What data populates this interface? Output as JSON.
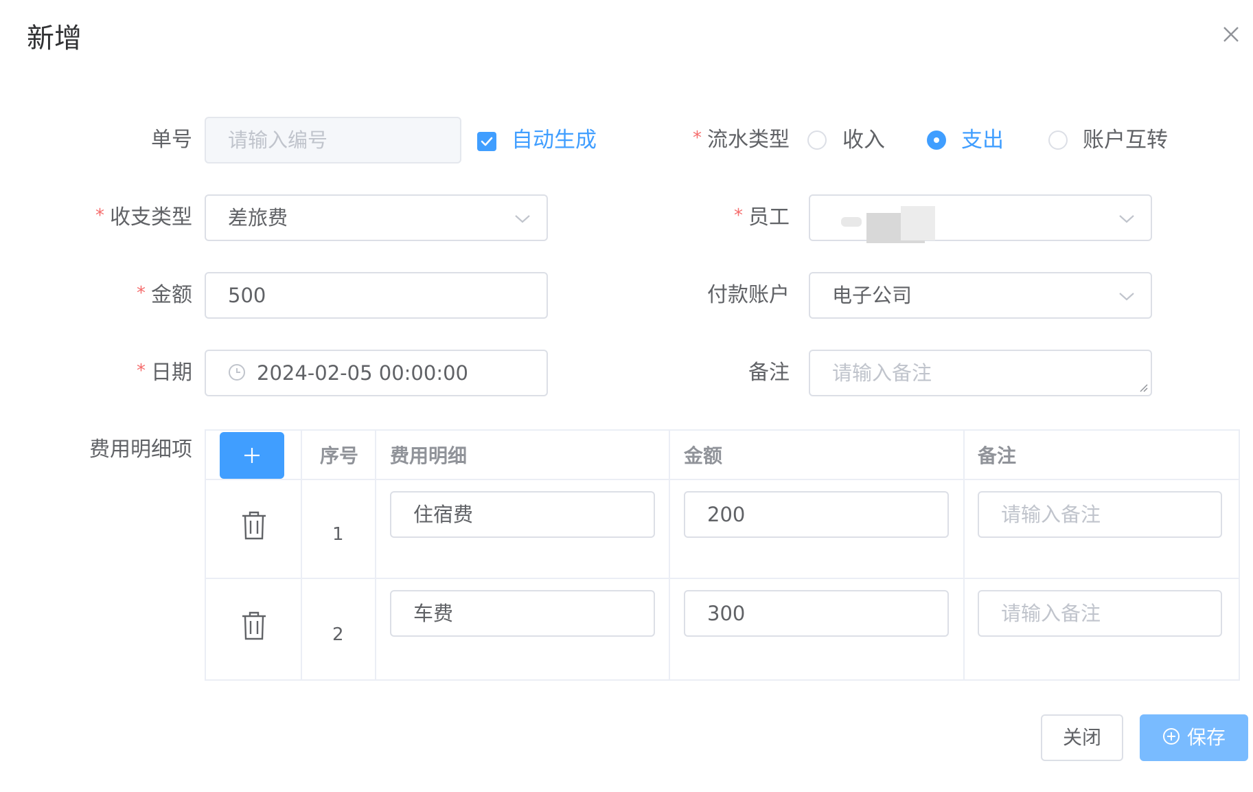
{
  "dialog": {
    "title": "新增"
  },
  "form": {
    "order_no": {
      "label": "单号",
      "placeholder": "请输入编号",
      "auto_label": "自动生成",
      "auto_checked": true
    },
    "flow_type": {
      "label": "流水类型",
      "options": [
        "收入",
        "支出",
        "账户互转"
      ],
      "selected": "支出"
    },
    "category": {
      "label": "收支类型",
      "value": "差旅费"
    },
    "employee": {
      "label": "员工",
      "value": ""
    },
    "amount": {
      "label": "金额",
      "value": "500"
    },
    "pay_account": {
      "label": "付款账户",
      "value": "电子公司"
    },
    "date": {
      "label": "日期",
      "value": "2024-02-05 00:00:00"
    },
    "remark": {
      "label": "备注",
      "placeholder": "请输入备注"
    },
    "required_mark": "*"
  },
  "details": {
    "label": "费用明细项",
    "headers": {
      "seq": "序号",
      "item": "费用明细",
      "amount": "金额",
      "remark": "备注"
    },
    "rows": [
      {
        "seq": "1",
        "item": "住宿费",
        "amount": "200",
        "remark_placeholder": "请输入备注"
      },
      {
        "seq": "2",
        "item": "车费",
        "amount": "300",
        "remark_placeholder": "请输入备注"
      }
    ]
  },
  "footer": {
    "close_label": "关闭",
    "save_label": "保存"
  },
  "colors": {
    "primary": "#409eff",
    "save_disabled": "#79bbff",
    "required": "#f56c6c",
    "border": "#dcdfe6"
  },
  "icons": [
    "close-icon",
    "check-icon",
    "chevron-down-icon",
    "clock-icon",
    "plus-icon",
    "trash-icon",
    "plus-circle-icon"
  ]
}
